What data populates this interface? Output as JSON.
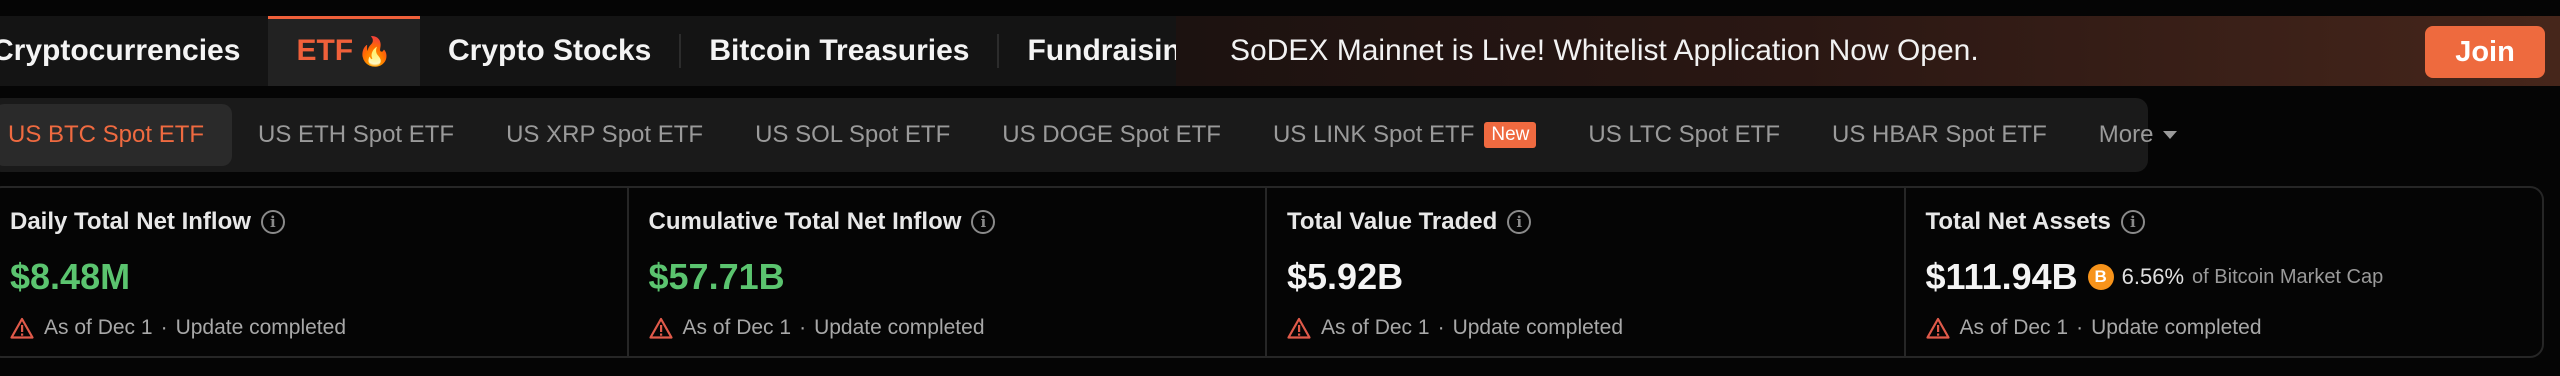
{
  "nav": {
    "tabs": [
      {
        "label": "Cryptocurrencies"
      },
      {
        "label": "ETF",
        "icon": "flame-icon"
      },
      {
        "label": "Crypto Stocks"
      },
      {
        "label": "Bitcoin Treasuries"
      },
      {
        "label": "Fundraising"
      }
    ],
    "active_tab": "ETF",
    "accent_color": "#f0603a"
  },
  "banner": {
    "text": "SoDEX Mainnet is Live! Whitelist Application Now Open.",
    "button_label": "Join",
    "button_color": "#ee6a3e"
  },
  "subtabs": {
    "items": [
      {
        "label": "US BTC Spot ETF"
      },
      {
        "label": "US ETH Spot ETF"
      },
      {
        "label": "US XRP Spot ETF"
      },
      {
        "label": "US SOL Spot ETF"
      },
      {
        "label": "US DOGE Spot ETF"
      },
      {
        "label": "US LINK Spot ETF",
        "badge": "New"
      },
      {
        "label": "US LTC Spot ETF"
      },
      {
        "label": "US HBAR Spot ETF"
      },
      {
        "label": "More"
      }
    ],
    "active": "US BTC Spot ETF"
  },
  "stats": {
    "daily_inflow": {
      "label": "Daily Total Net Inflow",
      "value": "$8.48M",
      "date": "As of Dec 1",
      "status": "Update completed"
    },
    "cumulative_inflow": {
      "label": "Cumulative Total Net Inflow",
      "value": "$57.71B",
      "date": "As of Dec 1",
      "status": "Update completed"
    },
    "value_traded": {
      "label": "Total Value Traded",
      "value": "$5.92B",
      "date": "As of Dec 1",
      "status": "Update completed"
    },
    "net_assets": {
      "label": "Total Net Assets",
      "value": "$111.94B",
      "coin_symbol": "B",
      "percent": "6.56%",
      "percent_note": "of Bitcoin Market Cap",
      "date": "As of Dec 1",
      "status": "Update completed"
    },
    "separator": "·",
    "positive_color": "#5bc46f",
    "warning_color": "#e05a4a"
  }
}
